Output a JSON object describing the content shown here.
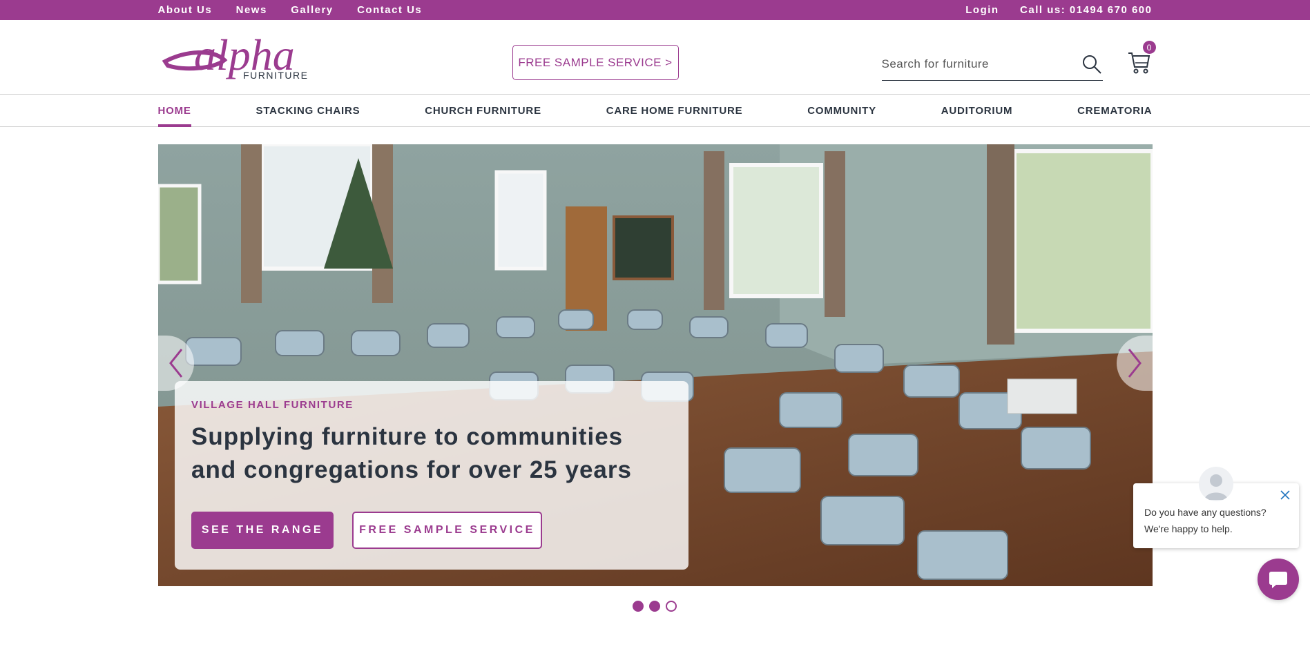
{
  "topbar": {
    "links": [
      "About Us",
      "News",
      "Gallery",
      "Contact Us"
    ],
    "login": "Login",
    "phone": "Call us: 01494 670 600"
  },
  "header": {
    "logo_wordmark": "alpha",
    "logo_sub": "FURNITURE",
    "sample_button": "FREE SAMPLE SERVICE >",
    "search_placeholder": "Search for furniture",
    "cart_count": "0"
  },
  "nav": {
    "items": [
      "HOME",
      "STACKING CHAIRS",
      "CHURCH FURNITURE",
      "CARE HOME FURNITURE",
      "COMMUNITY",
      "AUDITORIUM",
      "CREMATORIA"
    ],
    "active": "HOME"
  },
  "hero": {
    "eyebrow": "VILLAGE HALL FURNITURE",
    "heading_line1": "Supplying furniture to communities",
    "heading_line2": "and congregations for over 25 years",
    "primary_button": "SEE THE RANGE",
    "secondary_button": "FREE SAMPLE SERVICE",
    "slides_total": 3
  },
  "chat": {
    "line1": "Do you have any questions?",
    "line2": "We're happy to help."
  },
  "colors": {
    "brand": "#9b3b8f",
    "text": "#2b3440"
  }
}
